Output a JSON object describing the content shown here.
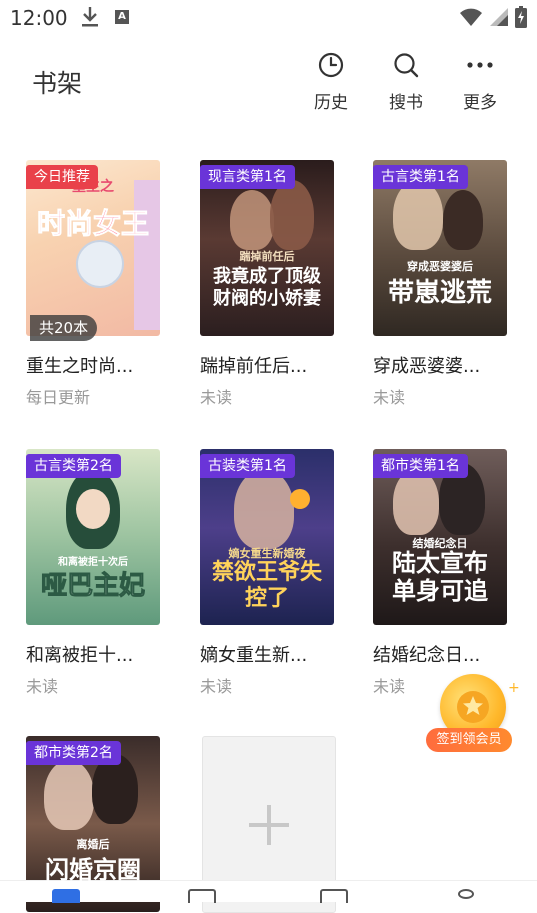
{
  "status_bar": {
    "time": "12:00",
    "icons": [
      "download-icon",
      "a-notification-icon",
      "wifi-icon",
      "signal-icon",
      "battery-icon"
    ]
  },
  "header": {
    "title": "书架",
    "actions": [
      {
        "label": "历史",
        "icon": "clock-icon"
      },
      {
        "label": "搜书",
        "icon": "search-icon"
      },
      {
        "label": "更多",
        "icon": "more-dots-icon"
      }
    ]
  },
  "books": [
    {
      "badge": "今日推荐",
      "badge_color": "#e9414a",
      "count": "共20本",
      "title": "重生之时尚...",
      "status": "每日更新",
      "cover_text": "时尚女王",
      "cover_small": "重生之"
    },
    {
      "badge": "现言类第1名",
      "badge_color": "#6a34d8",
      "title": "踹掉前任后...",
      "status": "未读",
      "cover_text": "我竟成了顶级财阀的小娇妻",
      "cover_small": "踹掉前任后"
    },
    {
      "badge": "古言类第1名",
      "badge_color": "#6a34d8",
      "title": "穿成恶婆婆...",
      "status": "未读",
      "cover_text": "带崽逃荒",
      "cover_small": "穿成恶婆婆后"
    },
    {
      "badge": "古言类第2名",
      "badge_color": "#6a34d8",
      "title": "和离被拒十...",
      "status": "未读",
      "cover_text": "哑巴主妃",
      "cover_small": "和离被拒十次后"
    },
    {
      "badge": "古装类第1名",
      "badge_color": "#6a34d8",
      "title": "嫡女重生新...",
      "status": "未读",
      "cover_text": "禁欲王爷失控了",
      "cover_small": "嫡女重生新婚夜"
    },
    {
      "badge": "都市类第1名",
      "badge_color": "#6a34d8",
      "title": "结婚纪念日...",
      "status": "未读",
      "cover_text": "陆太宣布单身可追",
      "cover_small": "结婚纪念日"
    },
    {
      "badge": "都市类第2名",
      "badge_color": "#6a34d8",
      "title": "",
      "status": "",
      "cover_text": "闪婚京圈",
      "cover_small": "离婚后"
    }
  ],
  "reward": {
    "label": "签到领会员"
  },
  "colors": {
    "badge_purple": "#6a34d8",
    "badge_red": "#e9414a",
    "reward_orange": "#ff7a35"
  }
}
